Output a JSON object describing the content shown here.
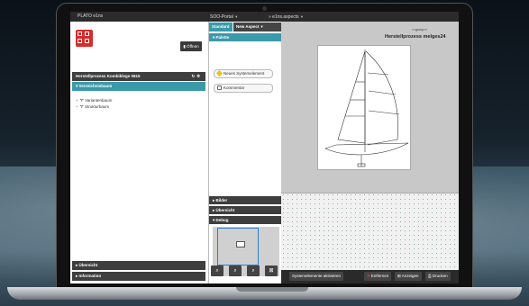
{
  "window": {
    "app_name": "PLATO e1ns",
    "crumb_portal": "SOO-Portal",
    "crumb_aspects": "e1ns.aspects"
  },
  "left_panel": {
    "open_button": "Öffnen",
    "project_title": "Herstellprozess Kombiklege 0815",
    "tree_header": "Verzeichnisbaum",
    "tree_items": [
      "Variantenbaum",
      "Strukturbaum"
    ],
    "accordion_bottom": [
      "Übersicht",
      "Information"
    ]
  },
  "middle_panel": {
    "tabs": [
      "Standard",
      "New Aspect"
    ],
    "palette_header": "Palette",
    "palette_buttons": [
      "Neues Systemelement",
      "Kommentar"
    ],
    "accordion": [
      "Bilder",
      "Übersicht",
      "Debug"
    ],
    "zoom_icons": [
      "zoom-out-icon",
      "zoom-in-icon",
      "zoom-fit-icon",
      "fit-screen-icon"
    ]
  },
  "canvas": {
    "group_label": "<<group>>",
    "title": "Herstellprozess melges24",
    "toolbar": {
      "activate": "Systemelemente aktivieren",
      "remove": "Entfernen",
      "show": "Anzeigen",
      "print": "Drucken"
    }
  },
  "colors": {
    "accent": "#3b9aa9",
    "logo": "#d62b2b",
    "header_dark": "#3e3e3e"
  }
}
